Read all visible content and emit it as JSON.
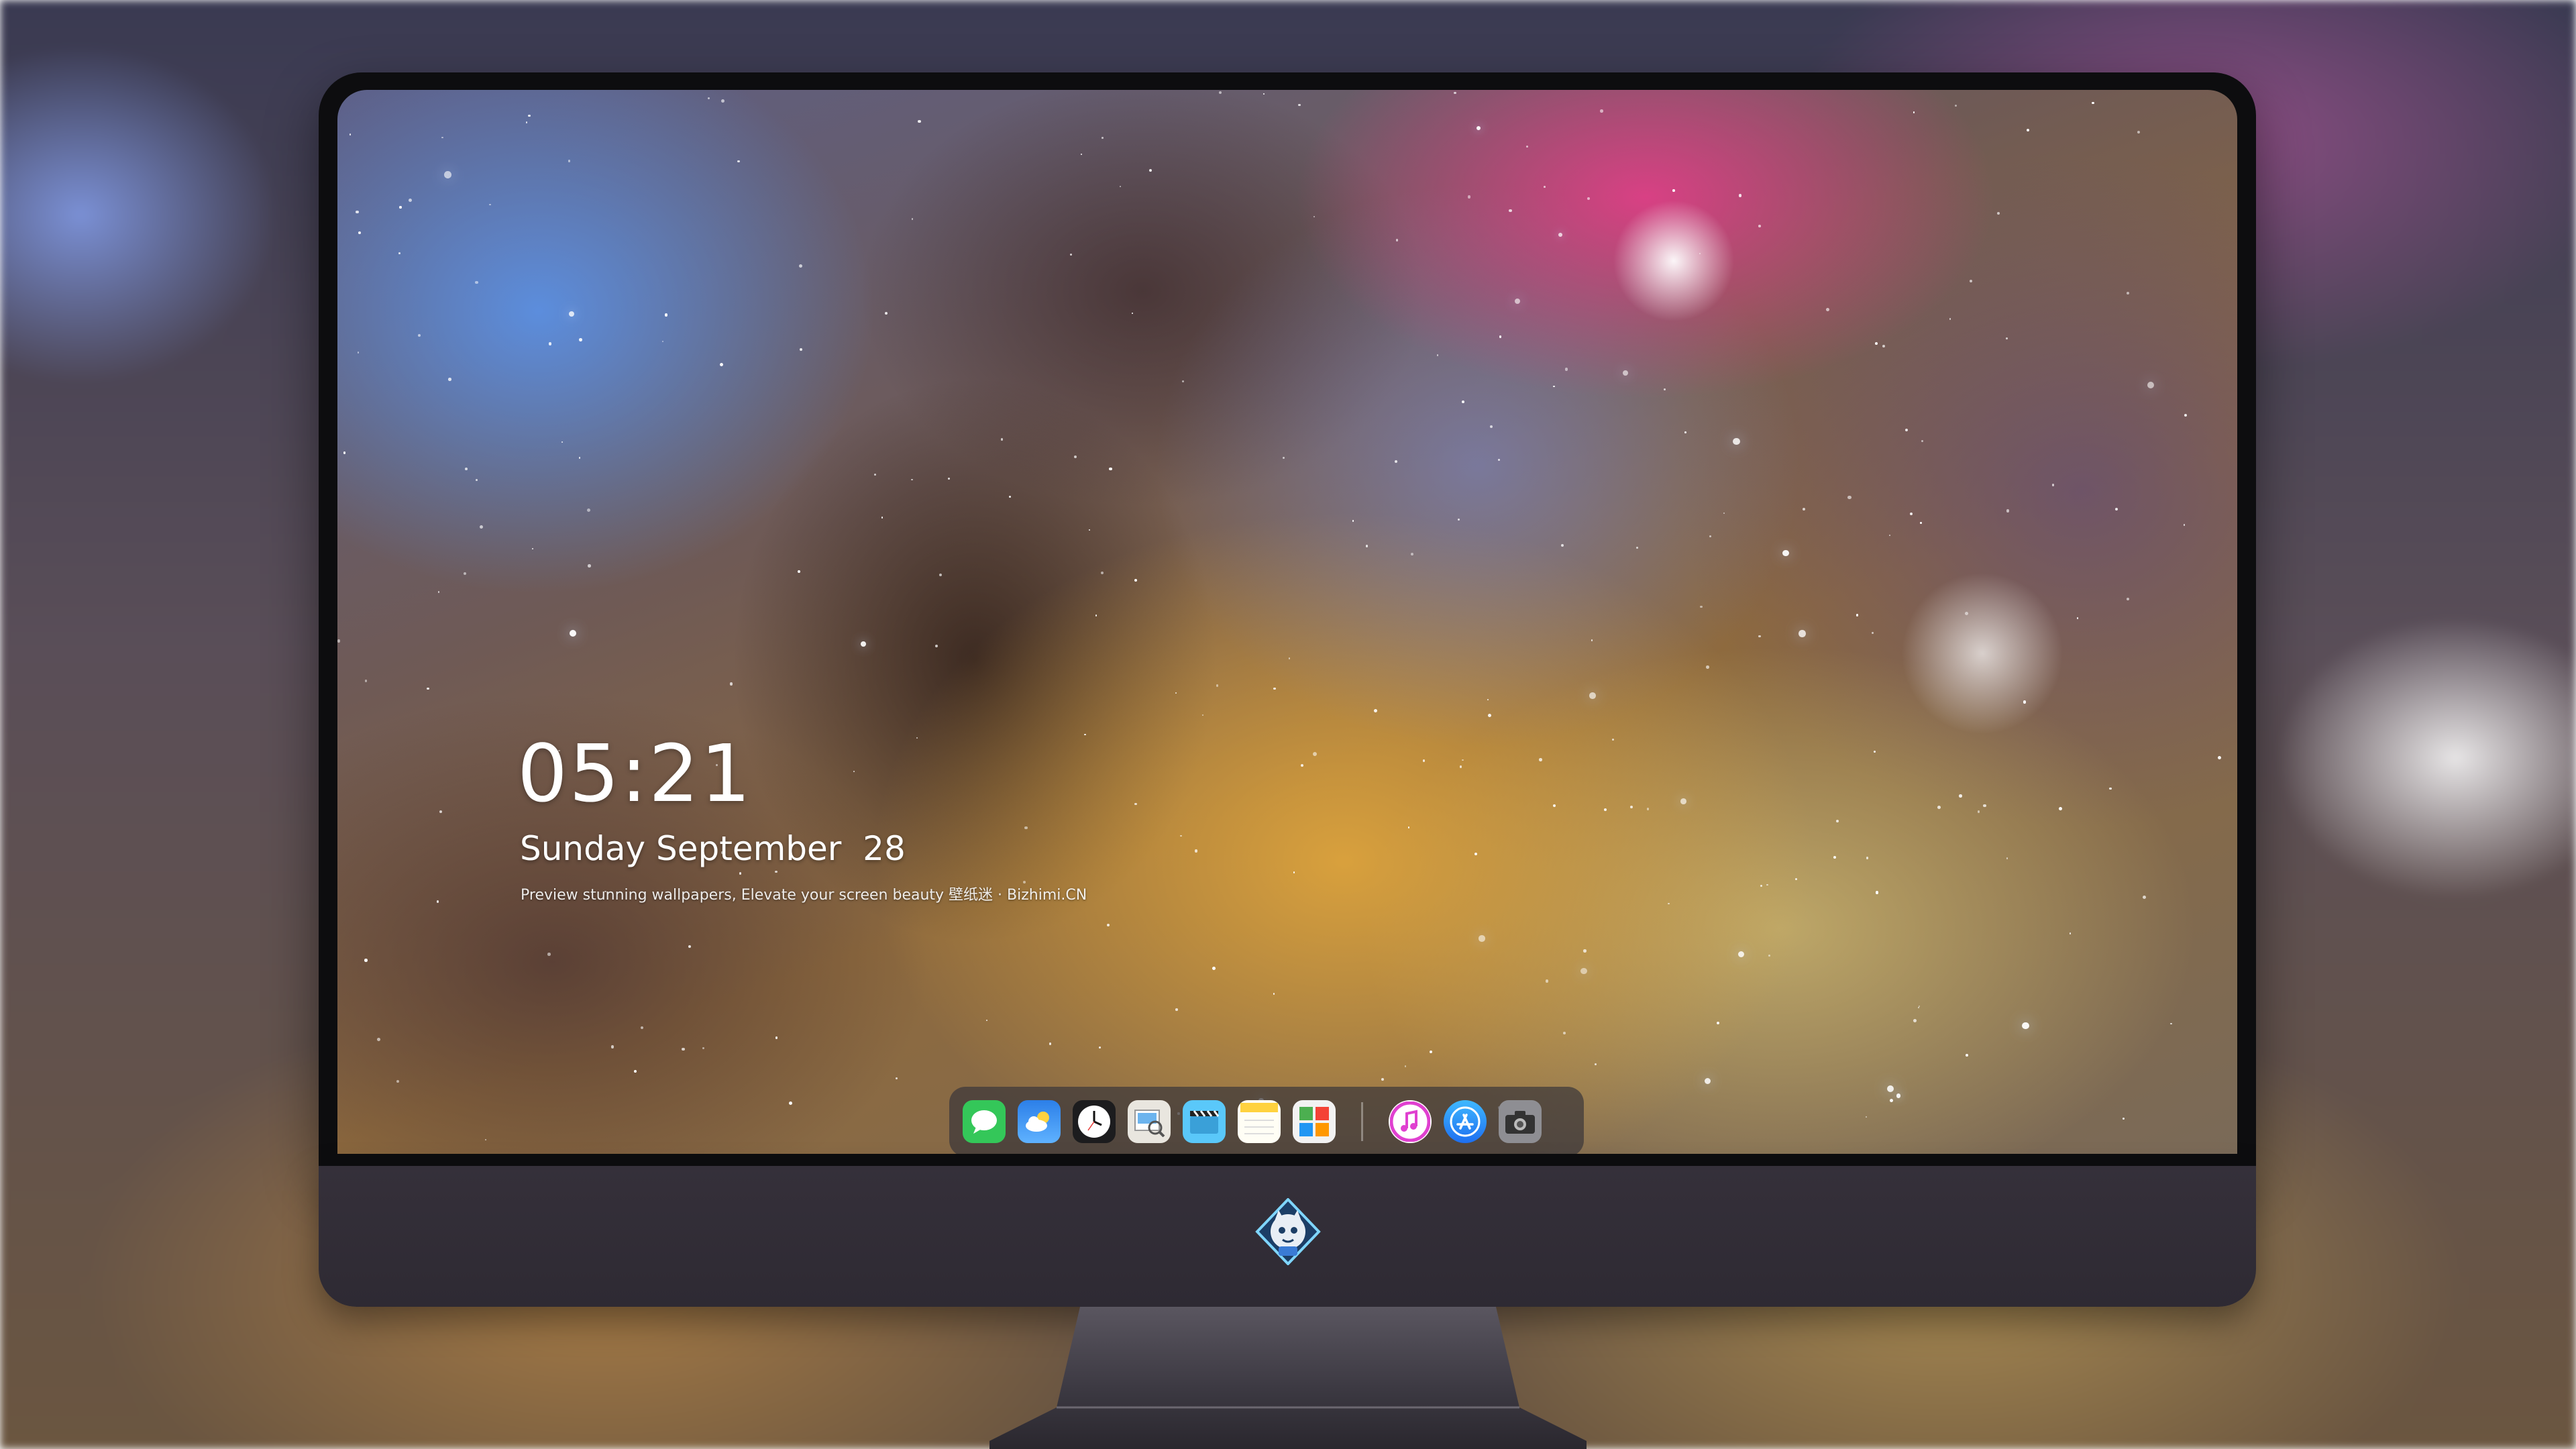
{
  "lockscreen": {
    "time": "05:21",
    "date": "Sunday September  28",
    "tagline": "Preview stunning wallpapers, Elevate your screen beauty  壁纸迷 · Bizhimi.CN"
  },
  "dock": {
    "apps": [
      {
        "name": "messages-icon",
        "color": "#34c759"
      },
      {
        "name": "weather-icon",
        "color": "#3a8ef0"
      },
      {
        "name": "clock-icon",
        "color": "#1c1c1e"
      },
      {
        "name": "preview-icon",
        "color": "#e9e6df"
      },
      {
        "name": "clips-icon",
        "color": "#5ac8fa"
      },
      {
        "name": "notes-icon",
        "color": "#ffd23f"
      },
      {
        "name": "photo-booth-icon",
        "color": "#f5f5f5"
      },
      {
        "name": "itunes-icon",
        "color": "#e040d0"
      },
      {
        "name": "app-store-icon",
        "color": "#1e90ff"
      },
      {
        "name": "camera-icon",
        "color": "#8e8e93"
      }
    ]
  },
  "monitor": {
    "logo": "bizhimi-mascot-logo"
  }
}
